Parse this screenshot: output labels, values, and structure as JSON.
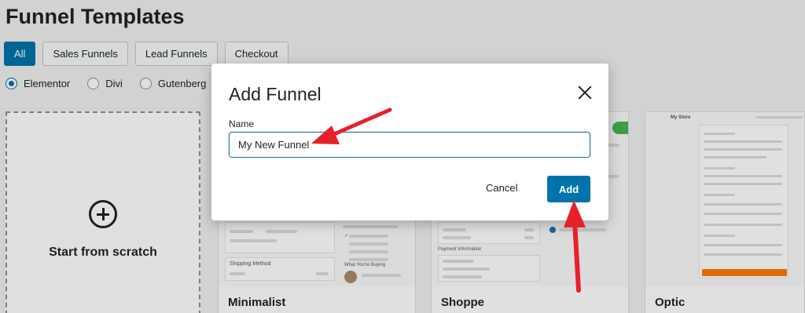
{
  "page": {
    "title": "Funnel Templates",
    "tabs": [
      {
        "label": "All",
        "active": true
      },
      {
        "label": "Sales Funnels",
        "active": false
      },
      {
        "label": "Lead Funnels",
        "active": false
      },
      {
        "label": "Checkout",
        "active": false
      }
    ],
    "builders": [
      {
        "label": "Elementor",
        "checked": true
      },
      {
        "label": "Divi",
        "checked": false
      },
      {
        "label": "Gutenberg",
        "checked": false
      }
    ],
    "scratch_label": "Start from scratch",
    "templates": [
      {
        "name": "Minimalist"
      },
      {
        "name": "Shoppe"
      },
      {
        "name": "Optic"
      }
    ],
    "preview_text": {
      "shipping_method": "Shipping Method",
      "payment_info": "Payment Information",
      "what_buying": "What You're Buying",
      "my_store": "My Store"
    }
  },
  "modal": {
    "title": "Add Funnel",
    "name_label": "Name",
    "name_value": "My New Funnel",
    "cancel_label": "Cancel",
    "add_label": "Add"
  },
  "colors": {
    "accent": "#0073aa",
    "annotation_arrow": "#e8202a"
  }
}
